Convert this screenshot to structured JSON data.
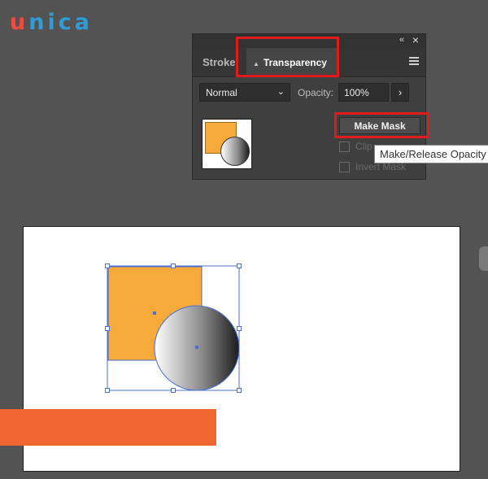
{
  "logo": {
    "part1": "u",
    "part2": "nica"
  },
  "panel": {
    "tabs": [
      {
        "label": "Stroke",
        "active": false
      },
      {
        "label": "Transparency",
        "active": true
      }
    ],
    "blend_mode": "Normal",
    "opacity_label": "Opacity:",
    "opacity_value": "100%",
    "make_mask_label": "Make Mask",
    "clip_label": "Clip",
    "invert_mask_label": "Invert Mask",
    "tooltip": "Make/Release Opacity Mask"
  },
  "icons": {
    "collapse": "double-chevron-left-icon",
    "close": "close-icon",
    "menu": "hamburger-menu-icon",
    "dropdown": "chevron-down-icon",
    "arrow": "chevron-right-icon"
  },
  "colors": {
    "highlight": "#e01b1b",
    "square": "#f7a93a",
    "bar": "#f06631",
    "selection": "#4a6fd1"
  }
}
